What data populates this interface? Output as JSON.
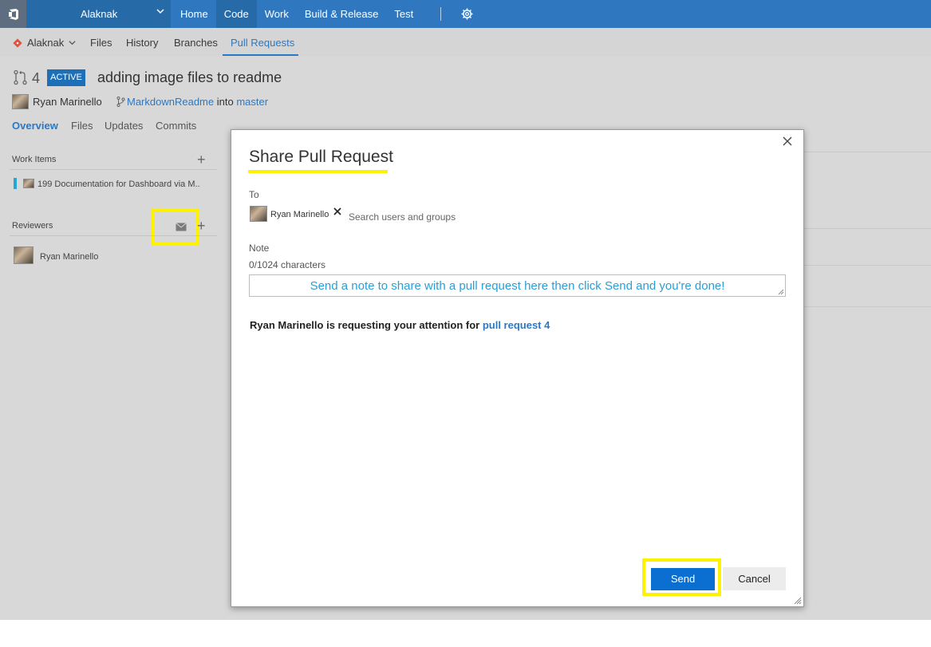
{
  "topbar": {
    "project": "Alaknak",
    "nav": [
      "Home",
      "Code",
      "Work",
      "Build & Release",
      "Test"
    ],
    "active_nav": "Code"
  },
  "subbar": {
    "repo": "Alaknak",
    "tabs": [
      "Files",
      "History",
      "Branches",
      "Pull Requests"
    ],
    "active_tab": "Pull Requests"
  },
  "pr": {
    "number": "4",
    "status": "ACTIVE",
    "title": "adding image files to readme",
    "author": "Ryan Marinello",
    "source_branch": "MarkdownReadme",
    "into": "into",
    "target_branch": "master",
    "tabs": [
      "Overview",
      "Files",
      "Updates",
      "Commits"
    ],
    "active_tab": "Overview"
  },
  "panel": {
    "work_items_title": "Work Items",
    "work_item": "199 Documentation for Dashboard via M..",
    "reviewers_title": "Reviewers",
    "reviewer": "Ryan Marinello"
  },
  "dialog": {
    "title": "Share Pull Request",
    "to_label": "To",
    "recipient": "Ryan Marinello",
    "search_placeholder": "Search users and groups",
    "note_label": "Note",
    "char_count": "0/1024 characters",
    "note_text": "Send a note to share with a pull request here then click Send and you're done!",
    "request_prefix": "Ryan Marinello is requesting your attention for",
    "request_link": "pull request 4",
    "send_label": "Send",
    "cancel_label": "Cancel"
  },
  "colors": {
    "topbar": "#2f78c0",
    "accent": "#2a79c6",
    "highlight": "#fff200",
    "send_button": "#0a6fd1",
    "badge": "#1d6fb8"
  }
}
